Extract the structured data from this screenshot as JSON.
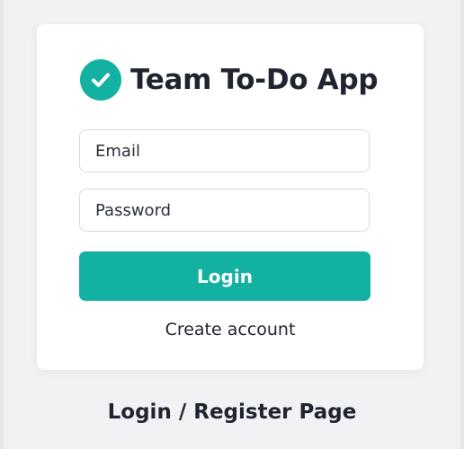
{
  "app": {
    "title": "Team To-Do App",
    "logo_icon": "check-circle-icon"
  },
  "form": {
    "email_placeholder": "Email",
    "email_value": "",
    "password_placeholder": "Password",
    "password_value": "",
    "login_label": "Login",
    "create_account_label": "Create account"
  },
  "caption": "Login / Register Page",
  "colors": {
    "accent": "#13b1a2",
    "background": "#f1f2f4",
    "card": "#ffffff",
    "text": "#1f2430"
  }
}
